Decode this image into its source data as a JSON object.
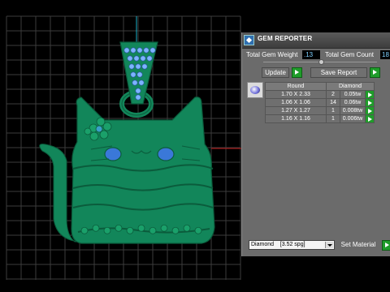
{
  "panel": {
    "title": "GEM REPORTER",
    "total_weight_label": "Total Gem Weight",
    "total_weight_value": ".13",
    "total_count_label": "Total Gem Count",
    "total_count_value": "18",
    "update_label": "Update",
    "save_label": "Save Report",
    "table": {
      "headers": [
        "Round",
        "Diamond"
      ],
      "rows": [
        {
          "size": "1.70 X 2.33",
          "count": "2",
          "weight": "0.05tw"
        },
        {
          "size": "1.06 X 1.06",
          "count": "14",
          "weight": "0.06tw"
        },
        {
          "size": "1.27 X 1.27",
          "count": "1",
          "weight": "0.008tw"
        },
        {
          "size": "1.16 X 1.16",
          "count": "1",
          "weight": "0.006tw"
        }
      ]
    },
    "material_select": "Diamond    [3.52 spg]",
    "set_material_label": "Set Material"
  },
  "colors": {
    "model": "#12865a",
    "gem": "#3a78d8",
    "grid": "#3c3c3c",
    "axis_x": "#c01818",
    "axis_y": "#1ab0c8",
    "accent_green": "#1f9c2a"
  }
}
